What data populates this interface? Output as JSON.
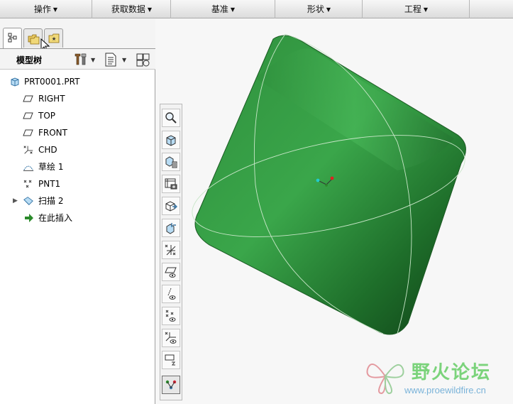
{
  "menu": {
    "items": [
      {
        "label": "操作"
      },
      {
        "label": "获取数据"
      },
      {
        "label": "基准"
      },
      {
        "label": "形状"
      },
      {
        "label": "工程"
      }
    ]
  },
  "model_tree": {
    "title": "模型树",
    "items": [
      {
        "label": "PRT0001.PRT",
        "icon": "part-icon"
      },
      {
        "label": "RIGHT",
        "icon": "datum-plane-icon"
      },
      {
        "label": "TOP",
        "icon": "datum-plane-icon"
      },
      {
        "label": "FRONT",
        "icon": "datum-plane-icon"
      },
      {
        "label": "CHD",
        "icon": "coordinate-system-icon"
      },
      {
        "label": "草绘 1",
        "icon": "sketch-icon"
      },
      {
        "label": "PNT1",
        "icon": "datum-point-icon"
      },
      {
        "label": "扫描 2",
        "icon": "sweep-icon"
      },
      {
        "label": "在此插入",
        "icon": "insert-here-arrow-icon"
      }
    ]
  },
  "watermark": {
    "title": "野火论坛",
    "url": "www.proewildfire.cn"
  },
  "colors": {
    "model_green": "#2e8b3c",
    "insert_arrow": "#2a8a2a",
    "watermark_green": "#7bd37b"
  }
}
